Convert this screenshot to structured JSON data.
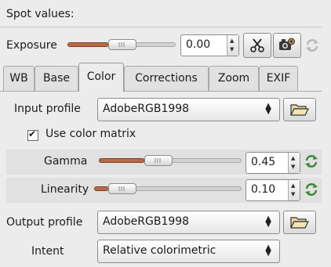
{
  "section": {
    "title": "Spot values:"
  },
  "exposure": {
    "label": "Exposure",
    "value": "0.00",
    "slider_fraction": 0.55,
    "buttons": [
      {
        "name": "scissors-icon"
      },
      {
        "name": "camera-icon"
      },
      {
        "name": "refresh-icon"
      }
    ]
  },
  "tabs": [
    {
      "label": "WB",
      "active": false
    },
    {
      "label": "Base",
      "active": false
    },
    {
      "label": "Color",
      "active": true
    },
    {
      "label": "Corrections",
      "active": false
    },
    {
      "label": "Zoom",
      "active": false
    },
    {
      "label": "EXIF",
      "active": false
    }
  ],
  "color": {
    "input_profile": {
      "label": "Input profile",
      "value": "AdobeRGB1998",
      "arrow": "⬍"
    },
    "use_color_matrix": {
      "label": "Use color matrix",
      "checked": true,
      "mark": "✔"
    },
    "gamma": {
      "label": "Gamma",
      "value": "0.45",
      "slider_fraction": 0.45
    },
    "linearity": {
      "label": "Linearity",
      "value": "0.10",
      "slider_fraction": 0.1
    },
    "output_profile": {
      "label": "Output profile",
      "value": "AdobeRGB1998",
      "arrow": "⬍"
    },
    "intent": {
      "label": "Intent",
      "value": "Relative colorimetric",
      "arrow": "⬍"
    }
  },
  "colors": {
    "slider_fill": "#b76a48",
    "accent_green": "#3c8a3c"
  }
}
